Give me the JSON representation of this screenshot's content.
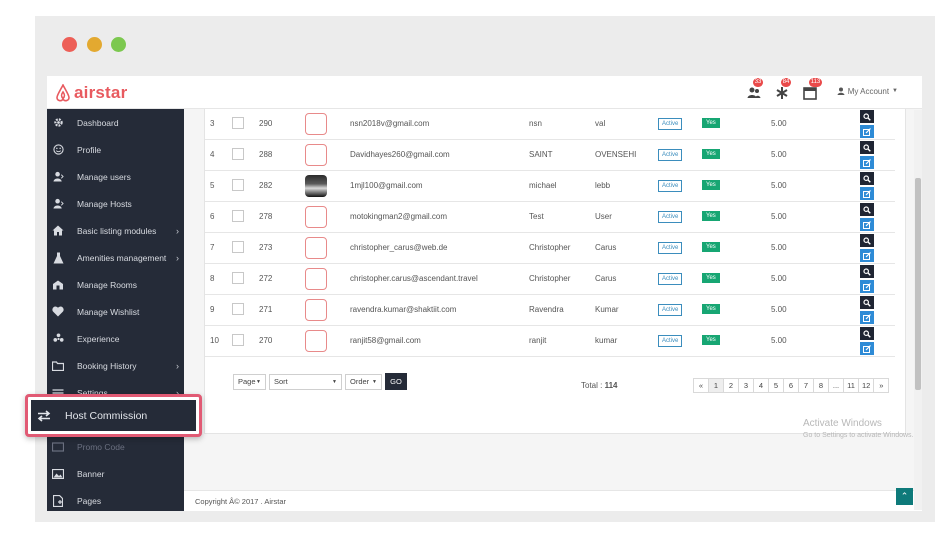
{
  "brand": {
    "name": "airstar",
    "accent": "#e85a5f"
  },
  "header": {
    "notifications": [
      {
        "icon": "users-icon",
        "count": "33"
      },
      {
        "icon": "asterisk-icon",
        "count": "84"
      },
      {
        "icon": "calendar-icon",
        "count": "113"
      }
    ],
    "account_label": "My Account"
  },
  "sidebar": {
    "items": [
      {
        "label": "Dashboard",
        "icon": "cog-icon",
        "has_children": false
      },
      {
        "label": "Profile",
        "icon": "smile-icon",
        "has_children": false
      },
      {
        "label": "Manage users",
        "icon": "user-icon",
        "has_children": false
      },
      {
        "label": "Manage Hosts",
        "icon": "user-icon",
        "has_children": false
      },
      {
        "label": "Basic listing modules",
        "icon": "home-icon",
        "has_children": true
      },
      {
        "label": "Amenities management",
        "icon": "flask-icon",
        "has_children": true
      },
      {
        "label": "Manage Rooms",
        "icon": "building-icon",
        "has_children": false
      },
      {
        "label": "Manage Wishlist",
        "icon": "heart-icon",
        "has_children": false
      },
      {
        "label": "Experience",
        "icon": "star-icon",
        "has_children": false
      },
      {
        "label": "Booking History",
        "icon": "folder-icon",
        "has_children": true
      },
      {
        "label": "Settings",
        "icon": "sliders-icon",
        "has_children": true
      },
      {
        "label": "Promo Code",
        "icon": "tag-icon",
        "has_children": false
      },
      {
        "label": "Banner",
        "icon": "image-icon",
        "has_children": false
      },
      {
        "label": "Pages",
        "icon": "file-icon",
        "has_children": false
      }
    ],
    "highlighted": {
      "label": "Host Commission",
      "icon": "exchange-icon"
    }
  },
  "table": {
    "rows": [
      {
        "index": "3",
        "id": "290",
        "email": "nsn2018v@gmail.com",
        "first": "nsn",
        "last": "val",
        "status": "Active",
        "verified": "Yes",
        "rating": "5.00",
        "has_photo": false
      },
      {
        "index": "4",
        "id": "288",
        "email": "Davidhayes260@gmail.com",
        "first": "SAINT",
        "last": "OVENSEHI",
        "status": "Active",
        "verified": "Yes",
        "rating": "5.00",
        "has_photo": false
      },
      {
        "index": "5",
        "id": "282",
        "email": "1mjl100@gmail.com",
        "first": "michael",
        "last": "lebb",
        "status": "Active",
        "verified": "Yes",
        "rating": "5.00",
        "has_photo": true
      },
      {
        "index": "6",
        "id": "278",
        "email": "motokingman2@gmail.com",
        "first": "Test",
        "last": "User",
        "status": "Active",
        "verified": "Yes",
        "rating": "5.00",
        "has_photo": false
      },
      {
        "index": "7",
        "id": "273",
        "email": "christopher_carus@web.de",
        "first": "Christopher",
        "last": "Carus",
        "status": "Active",
        "verified": "Yes",
        "rating": "5.00",
        "has_photo": false
      },
      {
        "index": "8",
        "id": "272",
        "email": "christopher.carus@ascendant.travel",
        "first": "Christopher",
        "last": "Carus",
        "status": "Active",
        "verified": "Yes",
        "rating": "5.00",
        "has_photo": false
      },
      {
        "index": "9",
        "id": "271",
        "email": "ravendra.kumar@shaktiit.com",
        "first": "Ravendra",
        "last": "Kumar",
        "status": "Active",
        "verified": "Yes",
        "rating": "5.00",
        "has_photo": false
      },
      {
        "index": "10",
        "id": "270",
        "email": "ranjit58@gmail.com",
        "first": "ranjit",
        "last": "kumar",
        "status": "Active",
        "verified": "Yes",
        "rating": "5.00",
        "has_photo": false
      }
    ]
  },
  "filters": {
    "page_label": "Page",
    "sort_label": "Sort",
    "order_label": "Order",
    "go_label": "GO"
  },
  "total": {
    "label": "Total :",
    "value": "114"
  },
  "pagination": [
    "«",
    "1",
    "2",
    "3",
    "4",
    "5",
    "6",
    "7",
    "8",
    "...",
    "11",
    "12",
    "»"
  ],
  "footer": {
    "copyright": "Copyright Â© 2017 . Airstar"
  },
  "watermark": {
    "line1": "Activate Windows",
    "line2": "Go to Settings to activate Windows."
  },
  "colors": {
    "sidebar_bg": "#252b38",
    "active_badge": "#3b8dbd",
    "yes_badge": "#17a673",
    "edit_btn": "#2e8bd6",
    "callout_border": "#e15a74"
  }
}
